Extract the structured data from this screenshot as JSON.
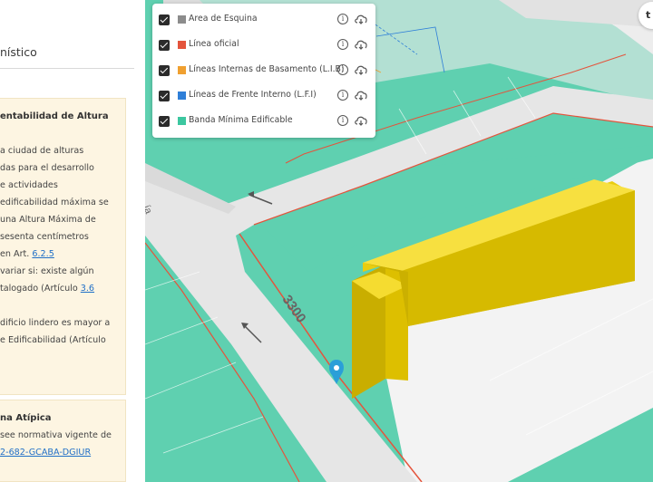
{
  "sidebar": {
    "title": "nístico",
    "card1": {
      "title": "entabilidad de Altura",
      "lines": [
        "a ciudad de alturas",
        "das para el desarrollo",
        "e actividades",
        "edificabilidad máxima se",
        "una Altura Máxima de",
        "sesenta centímetros",
        "en Art. ",
        "variar si: existe algún",
        "talogado (Artículo ",
        "",
        "dificio lindero es mayor a",
        "e Edificabilidad (Artículo"
      ],
      "link_art": "6.2.5",
      "link_art2": "3.6"
    },
    "card2": {
      "title": "na Atípica",
      "line1": "see normativa vigente de",
      "link": "2-682-GCABA-DGIUR"
    }
  },
  "layers": [
    {
      "label": "Area de Esquina",
      "color": "#8c8c8c"
    },
    {
      "label": "Línea oficial",
      "color": "#e4543c"
    },
    {
      "label": "Líneas Internas de Basamento (L.I.B)",
      "color": "#f0a030"
    },
    {
      "label": "Líneas de Frente Interno (L.F.I)",
      "color": "#2f7fd8"
    },
    {
      "label": "Banda Mínima Edificable",
      "color": "#3cc7a0"
    }
  ],
  "map": {
    "street_number": "3300",
    "street_fragment": "ía",
    "colors": {
      "green": "#5fd0b0",
      "road": "#e8e8e8",
      "building": "#f2d400",
      "marker": "#2a9fd8"
    }
  },
  "corner_button": "t"
}
